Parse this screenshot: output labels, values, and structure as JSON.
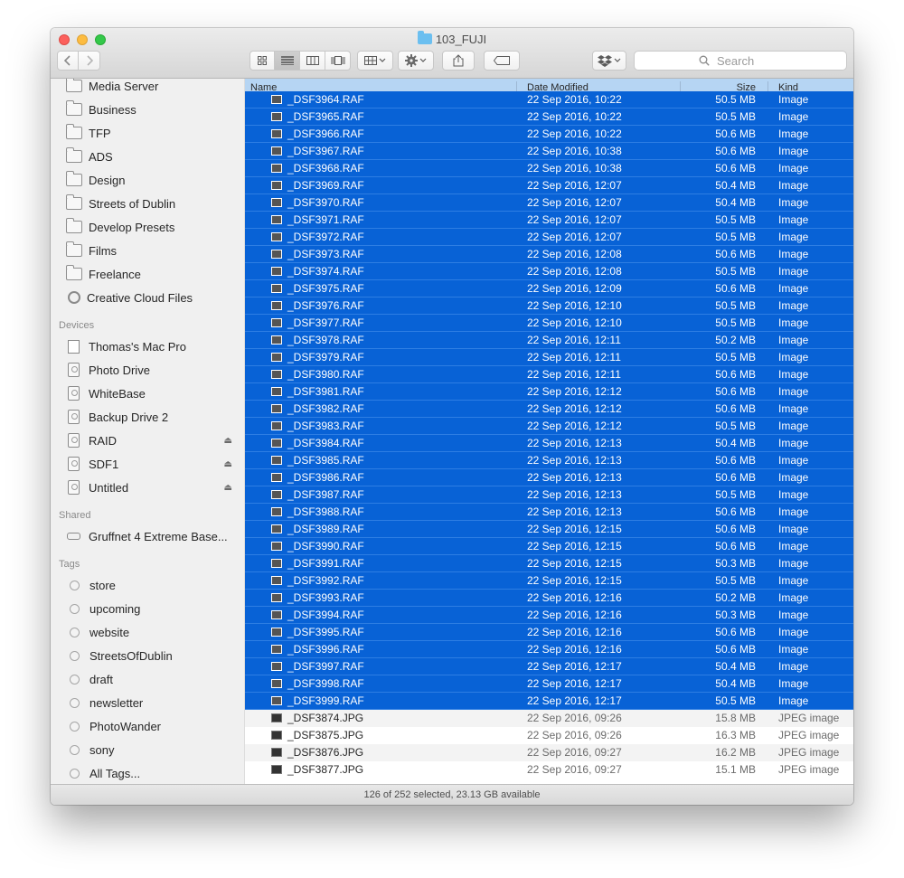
{
  "window": {
    "title": "103_FUJI"
  },
  "toolbar": {
    "back_icon": "chevron-left-icon",
    "forward_icon": "chevron-right-icon",
    "views": [
      "icon-view",
      "list-view",
      "column-view",
      "cover-flow-view"
    ],
    "active_view": "list-view",
    "search_placeholder": "Search"
  },
  "sidebar": {
    "favorites": [
      {
        "label": "Media Server",
        "icon": "folder-icon"
      },
      {
        "label": "Business",
        "icon": "folder-icon"
      },
      {
        "label": "TFP",
        "icon": "folder-icon"
      },
      {
        "label": "ADS",
        "icon": "folder-icon"
      },
      {
        "label": "Design",
        "icon": "folder-icon"
      },
      {
        "label": "Streets of Dublin",
        "icon": "folder-icon"
      },
      {
        "label": "Develop Presets",
        "icon": "folder-icon"
      },
      {
        "label": "Films",
        "icon": "folder-icon"
      },
      {
        "label": "Freelance",
        "icon": "folder-icon"
      },
      {
        "label": "Creative Cloud Files",
        "icon": "creative-cloud-icon"
      }
    ],
    "devices_heading": "Devices",
    "devices": [
      {
        "label": "Thomas's Mac Pro",
        "icon": "computer-icon",
        "eject": false
      },
      {
        "label": "Photo Drive",
        "icon": "drive-icon",
        "eject": false
      },
      {
        "label": "WhiteBase",
        "icon": "drive-icon",
        "eject": false
      },
      {
        "label": "Backup Drive 2",
        "icon": "drive-icon",
        "eject": false
      },
      {
        "label": "RAID",
        "icon": "drive-icon",
        "eject": true
      },
      {
        "label": "SDF1",
        "icon": "drive-icon",
        "eject": true
      },
      {
        "label": "Untitled",
        "icon": "drive-icon",
        "eject": true
      }
    ],
    "shared_heading": "Shared",
    "shared": [
      {
        "label": "Gruffnet 4 Extreme Base...",
        "icon": "network-icon"
      }
    ],
    "tags_heading": "Tags",
    "tags": [
      "store",
      "upcoming",
      "website",
      "StreetsOfDublin",
      "draft",
      "newsletter",
      "PhotoWander",
      "sony",
      "All Tags..."
    ]
  },
  "columns": {
    "name": "Name",
    "date": "Date Modified",
    "size": "Size",
    "kind": "Kind"
  },
  "files": [
    {
      "name": "_DSF3964.RAF",
      "date": "22 Sep 2016, 10:22",
      "size": "50.5 MB",
      "kind": "Image",
      "selected": true
    },
    {
      "name": "_DSF3965.RAF",
      "date": "22 Sep 2016, 10:22",
      "size": "50.5 MB",
      "kind": "Image",
      "selected": true
    },
    {
      "name": "_DSF3966.RAF",
      "date": "22 Sep 2016, 10:22",
      "size": "50.6 MB",
      "kind": "Image",
      "selected": true
    },
    {
      "name": "_DSF3967.RAF",
      "date": "22 Sep 2016, 10:38",
      "size": "50.6 MB",
      "kind": "Image",
      "selected": true
    },
    {
      "name": "_DSF3968.RAF",
      "date": "22 Sep 2016, 10:38",
      "size": "50.6 MB",
      "kind": "Image",
      "selected": true
    },
    {
      "name": "_DSF3969.RAF",
      "date": "22 Sep 2016, 12:07",
      "size": "50.4 MB",
      "kind": "Image",
      "selected": true
    },
    {
      "name": "_DSF3970.RAF",
      "date": "22 Sep 2016, 12:07",
      "size": "50.4 MB",
      "kind": "Image",
      "selected": true
    },
    {
      "name": "_DSF3971.RAF",
      "date": "22 Sep 2016, 12:07",
      "size": "50.5 MB",
      "kind": "Image",
      "selected": true
    },
    {
      "name": "_DSF3972.RAF",
      "date": "22 Sep 2016, 12:07",
      "size": "50.5 MB",
      "kind": "Image",
      "selected": true
    },
    {
      "name": "_DSF3973.RAF",
      "date": "22 Sep 2016, 12:08",
      "size": "50.6 MB",
      "kind": "Image",
      "selected": true
    },
    {
      "name": "_DSF3974.RAF",
      "date": "22 Sep 2016, 12:08",
      "size": "50.5 MB",
      "kind": "Image",
      "selected": true
    },
    {
      "name": "_DSF3975.RAF",
      "date": "22 Sep 2016, 12:09",
      "size": "50.6 MB",
      "kind": "Image",
      "selected": true
    },
    {
      "name": "_DSF3976.RAF",
      "date": "22 Sep 2016, 12:10",
      "size": "50.5 MB",
      "kind": "Image",
      "selected": true
    },
    {
      "name": "_DSF3977.RAF",
      "date": "22 Sep 2016, 12:10",
      "size": "50.5 MB",
      "kind": "Image",
      "selected": true
    },
    {
      "name": "_DSF3978.RAF",
      "date": "22 Sep 2016, 12:11",
      "size": "50.2 MB",
      "kind": "Image",
      "selected": true
    },
    {
      "name": "_DSF3979.RAF",
      "date": "22 Sep 2016, 12:11",
      "size": "50.5 MB",
      "kind": "Image",
      "selected": true
    },
    {
      "name": "_DSF3980.RAF",
      "date": "22 Sep 2016, 12:11",
      "size": "50.6 MB",
      "kind": "Image",
      "selected": true
    },
    {
      "name": "_DSF3981.RAF",
      "date": "22 Sep 2016, 12:12",
      "size": "50.6 MB",
      "kind": "Image",
      "selected": true
    },
    {
      "name": "_DSF3982.RAF",
      "date": "22 Sep 2016, 12:12",
      "size": "50.6 MB",
      "kind": "Image",
      "selected": true
    },
    {
      "name": "_DSF3983.RAF",
      "date": "22 Sep 2016, 12:12",
      "size": "50.5 MB",
      "kind": "Image",
      "selected": true
    },
    {
      "name": "_DSF3984.RAF",
      "date": "22 Sep 2016, 12:13",
      "size": "50.4 MB",
      "kind": "Image",
      "selected": true
    },
    {
      "name": "_DSF3985.RAF",
      "date": "22 Sep 2016, 12:13",
      "size": "50.6 MB",
      "kind": "Image",
      "selected": true
    },
    {
      "name": "_DSF3986.RAF",
      "date": "22 Sep 2016, 12:13",
      "size": "50.6 MB",
      "kind": "Image",
      "selected": true
    },
    {
      "name": "_DSF3987.RAF",
      "date": "22 Sep 2016, 12:13",
      "size": "50.5 MB",
      "kind": "Image",
      "selected": true
    },
    {
      "name": "_DSF3988.RAF",
      "date": "22 Sep 2016, 12:13",
      "size": "50.6 MB",
      "kind": "Image",
      "selected": true
    },
    {
      "name": "_DSF3989.RAF",
      "date": "22 Sep 2016, 12:15",
      "size": "50.6 MB",
      "kind": "Image",
      "selected": true
    },
    {
      "name": "_DSF3990.RAF",
      "date": "22 Sep 2016, 12:15",
      "size": "50.6 MB",
      "kind": "Image",
      "selected": true
    },
    {
      "name": "_DSF3991.RAF",
      "date": "22 Sep 2016, 12:15",
      "size": "50.3 MB",
      "kind": "Image",
      "selected": true
    },
    {
      "name": "_DSF3992.RAF",
      "date": "22 Sep 2016, 12:15",
      "size": "50.5 MB",
      "kind": "Image",
      "selected": true
    },
    {
      "name": "_DSF3993.RAF",
      "date": "22 Sep 2016, 12:16",
      "size": "50.2 MB",
      "kind": "Image",
      "selected": true
    },
    {
      "name": "_DSF3994.RAF",
      "date": "22 Sep 2016, 12:16",
      "size": "50.3 MB",
      "kind": "Image",
      "selected": true
    },
    {
      "name": "_DSF3995.RAF",
      "date": "22 Sep 2016, 12:16",
      "size": "50.6 MB",
      "kind": "Image",
      "selected": true
    },
    {
      "name": "_DSF3996.RAF",
      "date": "22 Sep 2016, 12:16",
      "size": "50.6 MB",
      "kind": "Image",
      "selected": true
    },
    {
      "name": "_DSF3997.RAF",
      "date": "22 Sep 2016, 12:17",
      "size": "50.4 MB",
      "kind": "Image",
      "selected": true
    },
    {
      "name": "_DSF3998.RAF",
      "date": "22 Sep 2016, 12:17",
      "size": "50.4 MB",
      "kind": "Image",
      "selected": true
    },
    {
      "name": "_DSF3999.RAF",
      "date": "22 Sep 2016, 12:17",
      "size": "50.5 MB",
      "kind": "Image",
      "selected": true
    },
    {
      "name": "_DSF3874.JPG",
      "date": "22 Sep 2016, 09:26",
      "size": "15.8 MB",
      "kind": "JPEG image",
      "selected": false
    },
    {
      "name": "_DSF3875.JPG",
      "date": "22 Sep 2016, 09:26",
      "size": "16.3 MB",
      "kind": "JPEG image",
      "selected": false
    },
    {
      "name": "_DSF3876.JPG",
      "date": "22 Sep 2016, 09:27",
      "size": "16.2 MB",
      "kind": "JPEG image",
      "selected": false
    },
    {
      "name": "_DSF3877.JPG",
      "date": "22 Sep 2016, 09:27",
      "size": "15.1 MB",
      "kind": "JPEG image",
      "selected": false
    }
  ],
  "status": "126 of 252 selected, 23.13 GB available",
  "colors": {
    "selection": "#0862d6",
    "header": "#b6d5f3",
    "folder": "#6bbff0"
  }
}
